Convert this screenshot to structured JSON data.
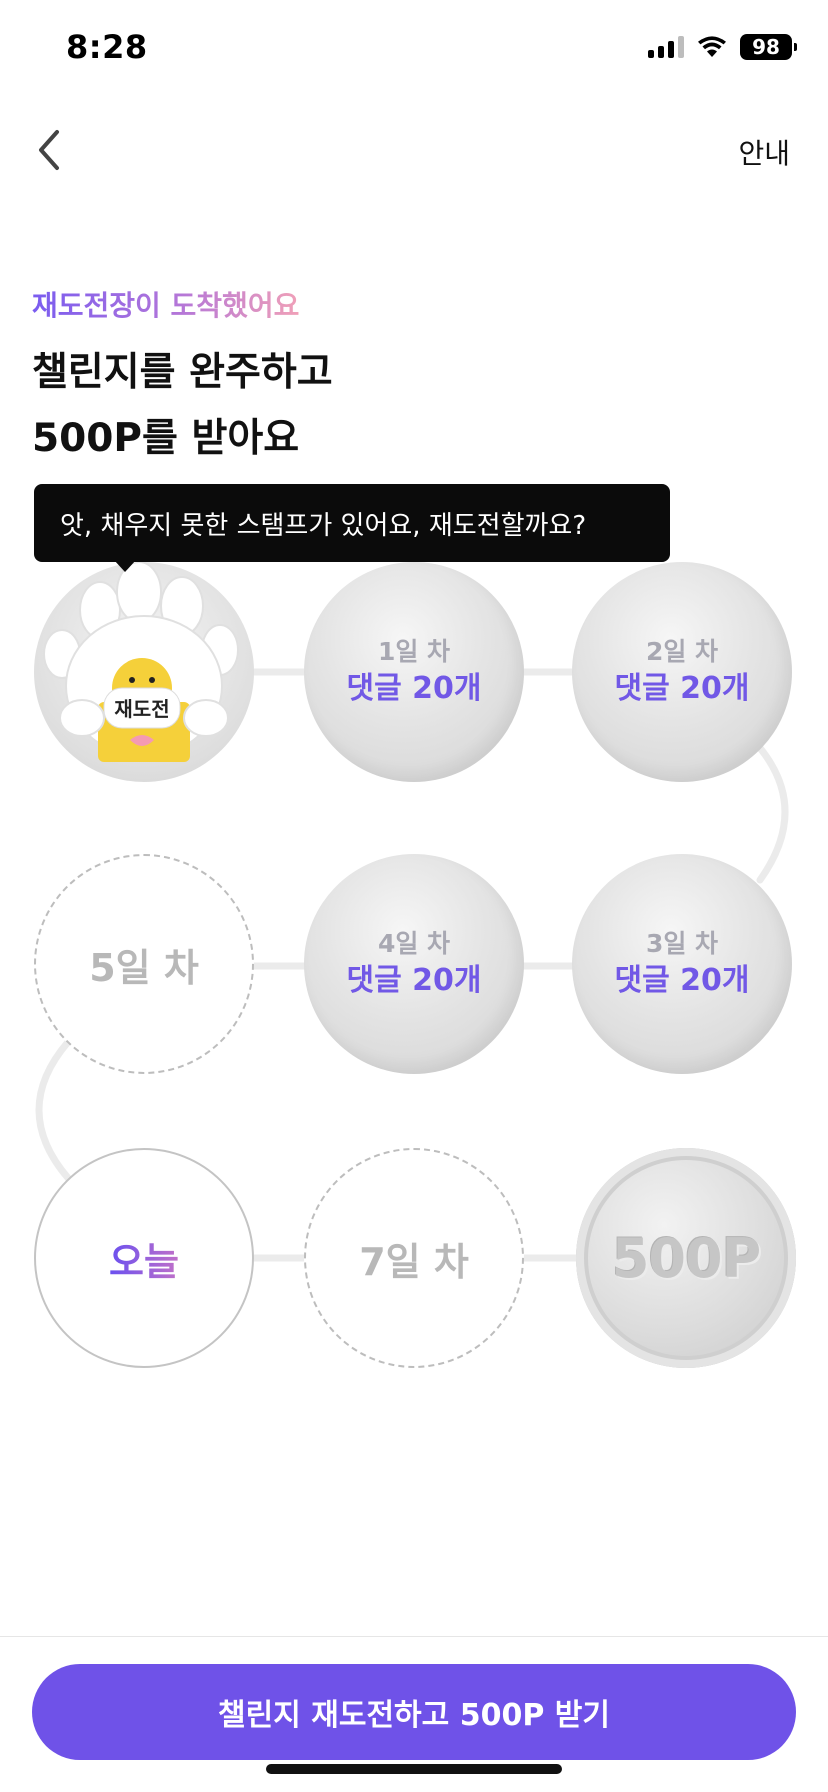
{
  "status_bar": {
    "time": "8:28",
    "battery": "98"
  },
  "nav": {
    "info_label": "안내"
  },
  "header": {
    "eyebrow": "재도전장이 도착했어요",
    "title_line1": "챌린지를 완주하고",
    "title_line2": "500P를 받아요"
  },
  "tooltip": {
    "text": "앗, 채우지 못한 스탬프가 있어요, 재도전할까요?"
  },
  "mascot": {
    "badge_text": "재도전"
  },
  "stamps": [
    {
      "day": "1일 차",
      "task": "댓글 20개"
    },
    {
      "day": "2일 차",
      "task": "댓글 20개"
    },
    {
      "day": "3일 차",
      "task": "댓글 20개"
    },
    {
      "day": "4일 차",
      "task": "댓글 20개"
    },
    {
      "day": "5일 차"
    },
    {
      "day": "오늘"
    },
    {
      "day": "7일 차"
    },
    {
      "reward": "500P"
    }
  ],
  "cta": {
    "label": "챌린지 재도전하고 500P 받기"
  },
  "colors": {
    "accent": "#6f52e8",
    "task_text": "#7158e6"
  }
}
